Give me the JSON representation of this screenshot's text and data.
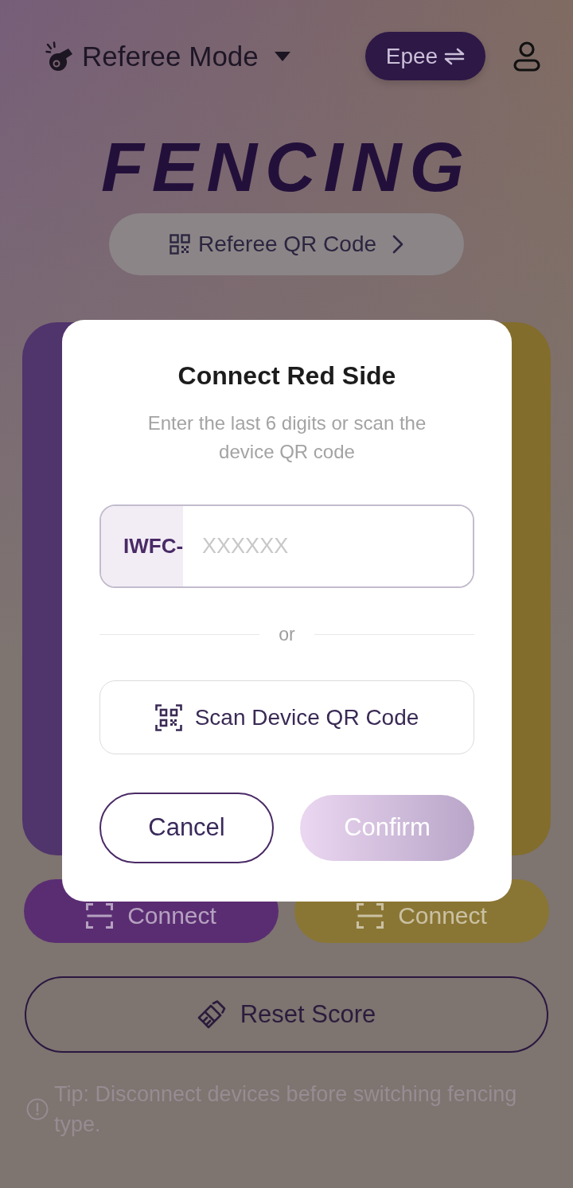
{
  "header": {
    "mode_selector": "Referee Mode",
    "weapon_toggle": "Epee"
  },
  "logo": "FENCING",
  "referee_qr_button": "Referee QR Code",
  "player_cards": [
    {
      "color": "#50346c"
    },
    {
      "color": "#826d2c"
    }
  ],
  "connect_buttons": [
    {
      "label": "Connect",
      "color": "#5a2d72"
    },
    {
      "label": "Connect",
      "color": "#8a7634"
    }
  ],
  "reset_button": "Reset Score",
  "tip": "Tip: Disconnect devices before switching fencing type.",
  "dialog": {
    "title": "Connect Red Side",
    "subtitle": "Enter the last 6 digits or scan the device QR code",
    "code_field": {
      "prefix": "IWFC-",
      "placeholder": "XXXXXX"
    },
    "divider": "or",
    "scan_button": "Scan Device QR Code",
    "buttons": [
      {
        "label": "Cancel",
        "kind": "outline",
        "disabled": false
      },
      {
        "label": "Confirm",
        "kind": "filled",
        "disabled": true
      }
    ]
  }
}
